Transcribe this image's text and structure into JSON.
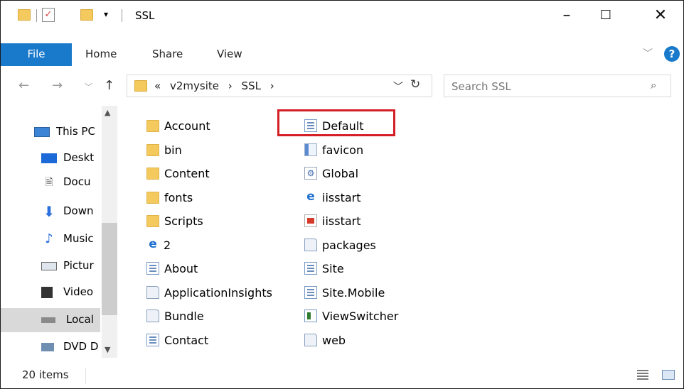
{
  "window": {
    "title": "SSL"
  },
  "ribbon": {
    "tabs": [
      "File",
      "Home",
      "Share",
      "View"
    ],
    "help_glyph": "?"
  },
  "address": {
    "breadcrumb": [
      "«",
      "v2mysite",
      "›",
      "SSL",
      "›"
    ]
  },
  "search": {
    "placeholder": "Search SSL"
  },
  "nav_pane": {
    "items": [
      {
        "label": "This PC",
        "icon": "monitor-icon"
      },
      {
        "label": "Deskt",
        "icon": "desktop-icon"
      },
      {
        "label": "Docu",
        "icon": "documents-icon"
      },
      {
        "label": "Down",
        "icon": "downloads-icon"
      },
      {
        "label": "Music",
        "icon": "music-icon"
      },
      {
        "label": "Pictur",
        "icon": "pictures-icon"
      },
      {
        "label": "Video",
        "icon": "videos-icon"
      },
      {
        "label": "Local",
        "icon": "drive-icon",
        "selected": true
      },
      {
        "label": "DVD D",
        "icon": "dvd-icon"
      }
    ]
  },
  "files": {
    "column1": [
      {
        "name": "Account",
        "type": "folder"
      },
      {
        "name": "bin",
        "type": "folder"
      },
      {
        "name": "Content",
        "type": "folder"
      },
      {
        "name": "fonts",
        "type": "folder"
      },
      {
        "name": "Scripts",
        "type": "folder"
      },
      {
        "name": "2",
        "type": "ie"
      },
      {
        "name": "About",
        "type": "config"
      },
      {
        "name": "ApplicationInsights",
        "type": "cs"
      },
      {
        "name": "Bundle",
        "type": "cs"
      },
      {
        "name": "Contact",
        "type": "config"
      }
    ],
    "column2": [
      {
        "name": "Default",
        "type": "config",
        "highlighted": true
      },
      {
        "name": "favicon",
        "type": "fav"
      },
      {
        "name": "Global",
        "type": "gear"
      },
      {
        "name": "iisstart",
        "type": "ie"
      },
      {
        "name": "iisstart",
        "type": "img"
      },
      {
        "name": "packages",
        "type": "cs"
      },
      {
        "name": "Site",
        "type": "config"
      },
      {
        "name": "Site.Mobile",
        "type": "config"
      },
      {
        "name": "ViewSwitcher",
        "type": "viewsw"
      },
      {
        "name": "web",
        "type": "cs"
      }
    ]
  },
  "status": {
    "item_count": "20 items"
  },
  "colors": {
    "accent": "#1979ca",
    "highlight": "#d41f26",
    "folder": "#f4c95d"
  }
}
